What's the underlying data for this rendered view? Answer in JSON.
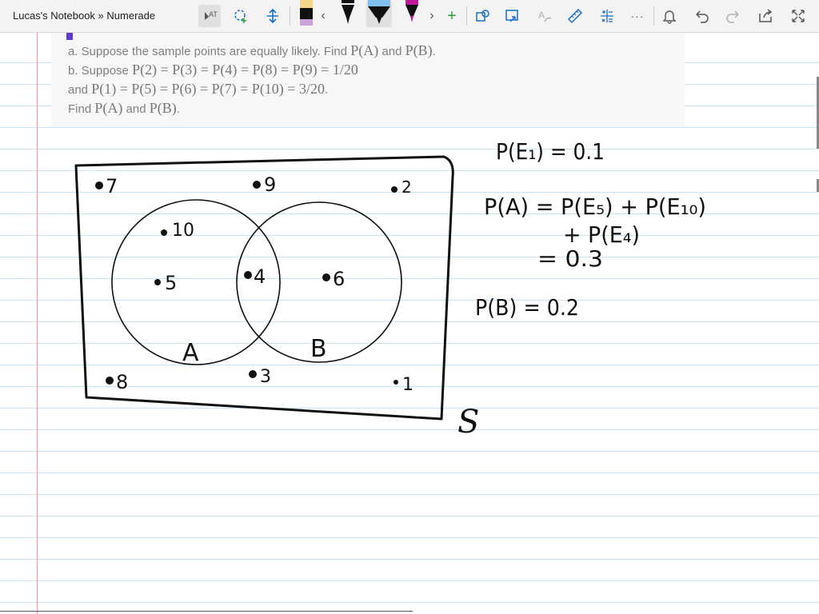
{
  "app": {
    "title": "Lucas's Notebook » Numerade"
  },
  "toolbar": {
    "buttons": [
      {
        "name": "lasso-select",
        "glyph": "⇱"
      },
      {
        "name": "add-space",
        "glyph": "⇕"
      },
      {
        "name": "scroll-left",
        "glyph": "‹"
      },
      {
        "name": "scroll-right",
        "glyph": "›"
      },
      {
        "name": "add-pen",
        "glyph": "+"
      },
      {
        "name": "shapes",
        "glyph": "▢"
      },
      {
        "name": "ink-to-shape",
        "glyph": "⬒"
      },
      {
        "name": "ink-to-text",
        "glyph": "A"
      },
      {
        "name": "ruler",
        "glyph": "📏"
      },
      {
        "name": "math",
        "glyph": "±"
      },
      {
        "name": "more",
        "glyph": "···"
      },
      {
        "name": "notifications",
        "glyph": "🔔"
      },
      {
        "name": "undo",
        "glyph": "↶"
      },
      {
        "name": "redo",
        "glyph": "↷"
      },
      {
        "name": "share",
        "glyph": "⇪"
      },
      {
        "name": "fullscreen",
        "glyph": "⤢"
      }
    ],
    "pen_colors": [
      "#f5d58a",
      "#111111",
      "#111111",
      "#7fc0ec",
      "#c0189a"
    ]
  },
  "problem": {
    "line_a_prefix": "a. Suppose the sample points are equally likely. Find ",
    "line_a_math1": "P(A)",
    "line_a_and": " and ",
    "line_a_math2": "P(B)",
    "line_a_end": ".",
    "line_b_prefix": "b. Suppose ",
    "line_b_math": "P(2) = P(3) = P(4) = P(8) = P(9) = 1/20",
    "line_c_prefix": "and ",
    "line_c_math": "P(1) = P(5) = P(6) = P(7) = P(10) = 3/20",
    "line_c_end": ".",
    "line_d_prefix": "Find ",
    "line_d_math1": "P(A)",
    "line_d_and": " and ",
    "line_d_math2": "P(B)",
    "line_d_end": "."
  },
  "venn": {
    "points": {
      "p7": "7",
      "p9": "9",
      "p2": "2",
      "p10": "10",
      "p5": "5",
      "p4": "4",
      "p6": "6",
      "p8": "8",
      "p3": "3",
      "p1": "1"
    },
    "label_a": "A",
    "label_b": "B",
    "label_s": "S"
  },
  "handwriting": {
    "line1": "P(E₁) = 0.1",
    "line2": "P(A) = P(E₅) + P(E₁₀)",
    "line3": "+ P(E₄)",
    "line4": "= 0.3",
    "line5": "P(B) = 0.2"
  }
}
